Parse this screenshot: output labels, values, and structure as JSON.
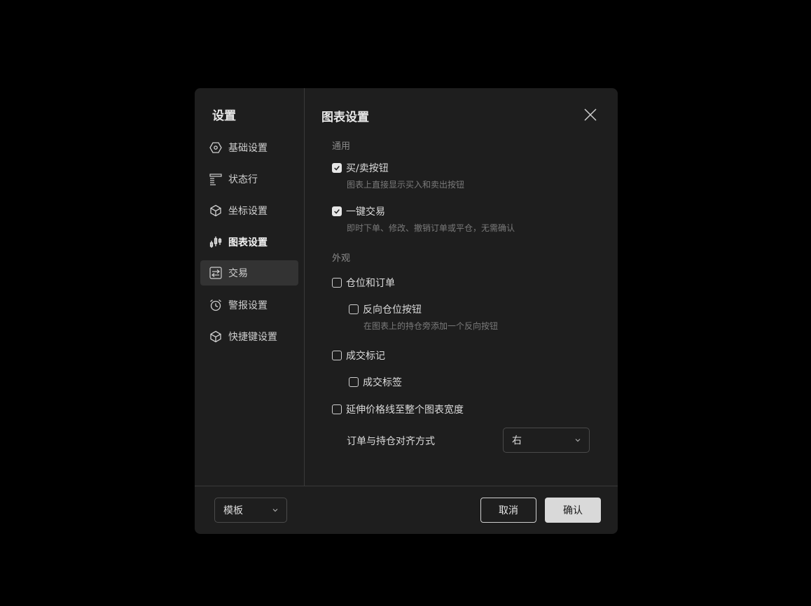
{
  "sidebar": {
    "title": "设置",
    "items": [
      {
        "label": "基础设置",
        "icon": "hexagon-gear-icon"
      },
      {
        "label": "状态行",
        "icon": "status-lines-icon"
      },
      {
        "label": "坐标设置",
        "icon": "cube-icon"
      },
      {
        "label": "图表设置",
        "icon": "candlestick-icon"
      },
      {
        "label": "交易",
        "icon": "swap-arrows-icon"
      },
      {
        "label": "警报设置",
        "icon": "alarm-clock-icon"
      },
      {
        "label": "快捷键设置",
        "icon": "cube-icon"
      }
    ]
  },
  "main": {
    "title": "图表设置",
    "sections": {
      "general": "通用",
      "appearance": "外观"
    },
    "options": {
      "buy_sell": {
        "label": "买/卖按钮",
        "desc": "图表上直接显示买入和卖出按钮",
        "checked": true
      },
      "one_click": {
        "label": "一键交易",
        "desc": "即时下单、修改、撤销订单或平仓，无需确认",
        "checked": true
      },
      "positions_orders": {
        "label": "仓位和订单",
        "checked": false
      },
      "reverse_btn": {
        "label": "反向仓位按钮",
        "desc": "在图表上的持仓旁添加一个反向按钮",
        "checked": false
      },
      "exec_marks": {
        "label": "成交标记",
        "checked": false
      },
      "exec_labels": {
        "label": "成交标签",
        "checked": false
      },
      "extend_lines": {
        "label": "延伸价格线至整个图表宽度",
        "checked": false
      }
    },
    "alignment": {
      "label": "订单与持仓对齐方式",
      "value": "右"
    }
  },
  "footer": {
    "template": "模板",
    "cancel": "取消",
    "confirm": "确认"
  },
  "colors": {
    "background": "#1e1e1e",
    "selected": "#333333",
    "accent": "#d9d9d9"
  }
}
